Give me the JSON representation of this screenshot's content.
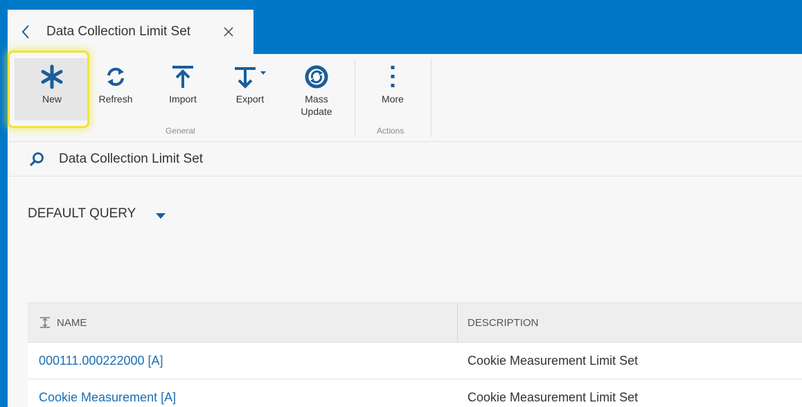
{
  "tab": {
    "title": "Data Collection Limit Set"
  },
  "ribbon": {
    "buttons": [
      {
        "label": "New",
        "icon": "asterisk-icon"
      },
      {
        "label": "Refresh",
        "icon": "refresh-icon"
      },
      {
        "label": "Import",
        "icon": "import-icon"
      },
      {
        "label": "Export",
        "icon": "export-icon"
      },
      {
        "label": "Mass Update",
        "icon": "mass-update-icon"
      },
      {
        "label": "More",
        "icon": "more-vertical-icon"
      }
    ],
    "groups": {
      "general": "General",
      "actions": "Actions"
    }
  },
  "search": {
    "text": "Data Collection Limit Set"
  },
  "query": {
    "label": "DEFAULT QUERY"
  },
  "grid": {
    "columns": [
      "NAME",
      "DESCRIPTION"
    ],
    "rows": [
      {
        "name": "000111.000222000 [A]",
        "description": "Cookie Measurement Limit Set"
      },
      {
        "name": "Cookie Measurement [A]",
        "description": "Cookie Measurement Limit Set"
      }
    ]
  },
  "colors": {
    "brand": "#0078c8",
    "link": "#1a6fb5",
    "highlight": "#f0e33a",
    "icon": "#1a5d9a"
  }
}
